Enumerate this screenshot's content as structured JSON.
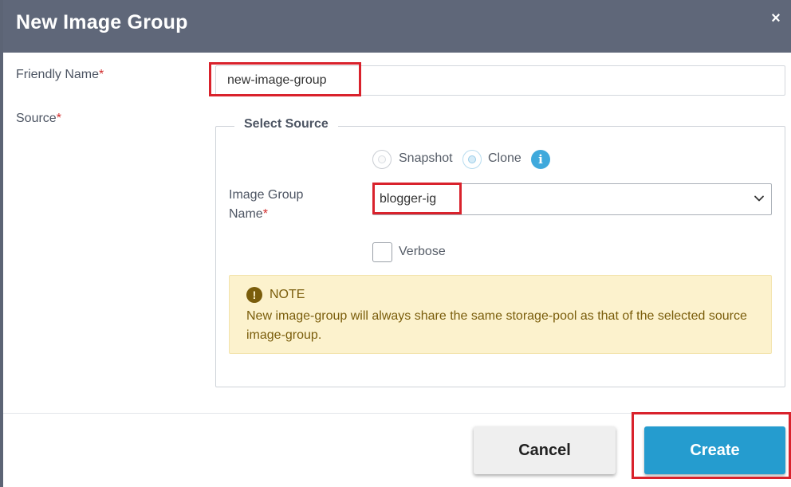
{
  "dialog": {
    "title": "New Image Group",
    "close_symbol": "×"
  },
  "form": {
    "friendly_name": {
      "label": "Friendly Name",
      "required_marker": "*",
      "value": "new-image-group"
    },
    "source": {
      "label": "Source",
      "required_marker": "*",
      "fieldset_legend": "Select Source",
      "options": [
        {
          "label": "Snapshot",
          "selected": false
        },
        {
          "label": "Clone",
          "selected": true
        }
      ],
      "info_icon": "info-icon",
      "image_group_name": {
        "label_line1": "Image Group",
        "label_line2": "Name",
        "required_marker": "*",
        "selected_value": "blogger-ig"
      },
      "verbose": {
        "label": "Verbose",
        "checked": false
      },
      "note": {
        "icon": "exclamation-icon",
        "title": "NOTE",
        "text": "New image-group will always share the same storage-pool as that of the selected source image-group."
      }
    }
  },
  "footer": {
    "cancel_label": "Cancel",
    "create_label": "Create"
  },
  "colors": {
    "header_bg": "#5f6779",
    "primary": "#259ccf",
    "required": "#d12b2b",
    "highlight": "#d9222c",
    "note_bg": "#fcf2cd",
    "note_text": "#7a5d0b"
  }
}
